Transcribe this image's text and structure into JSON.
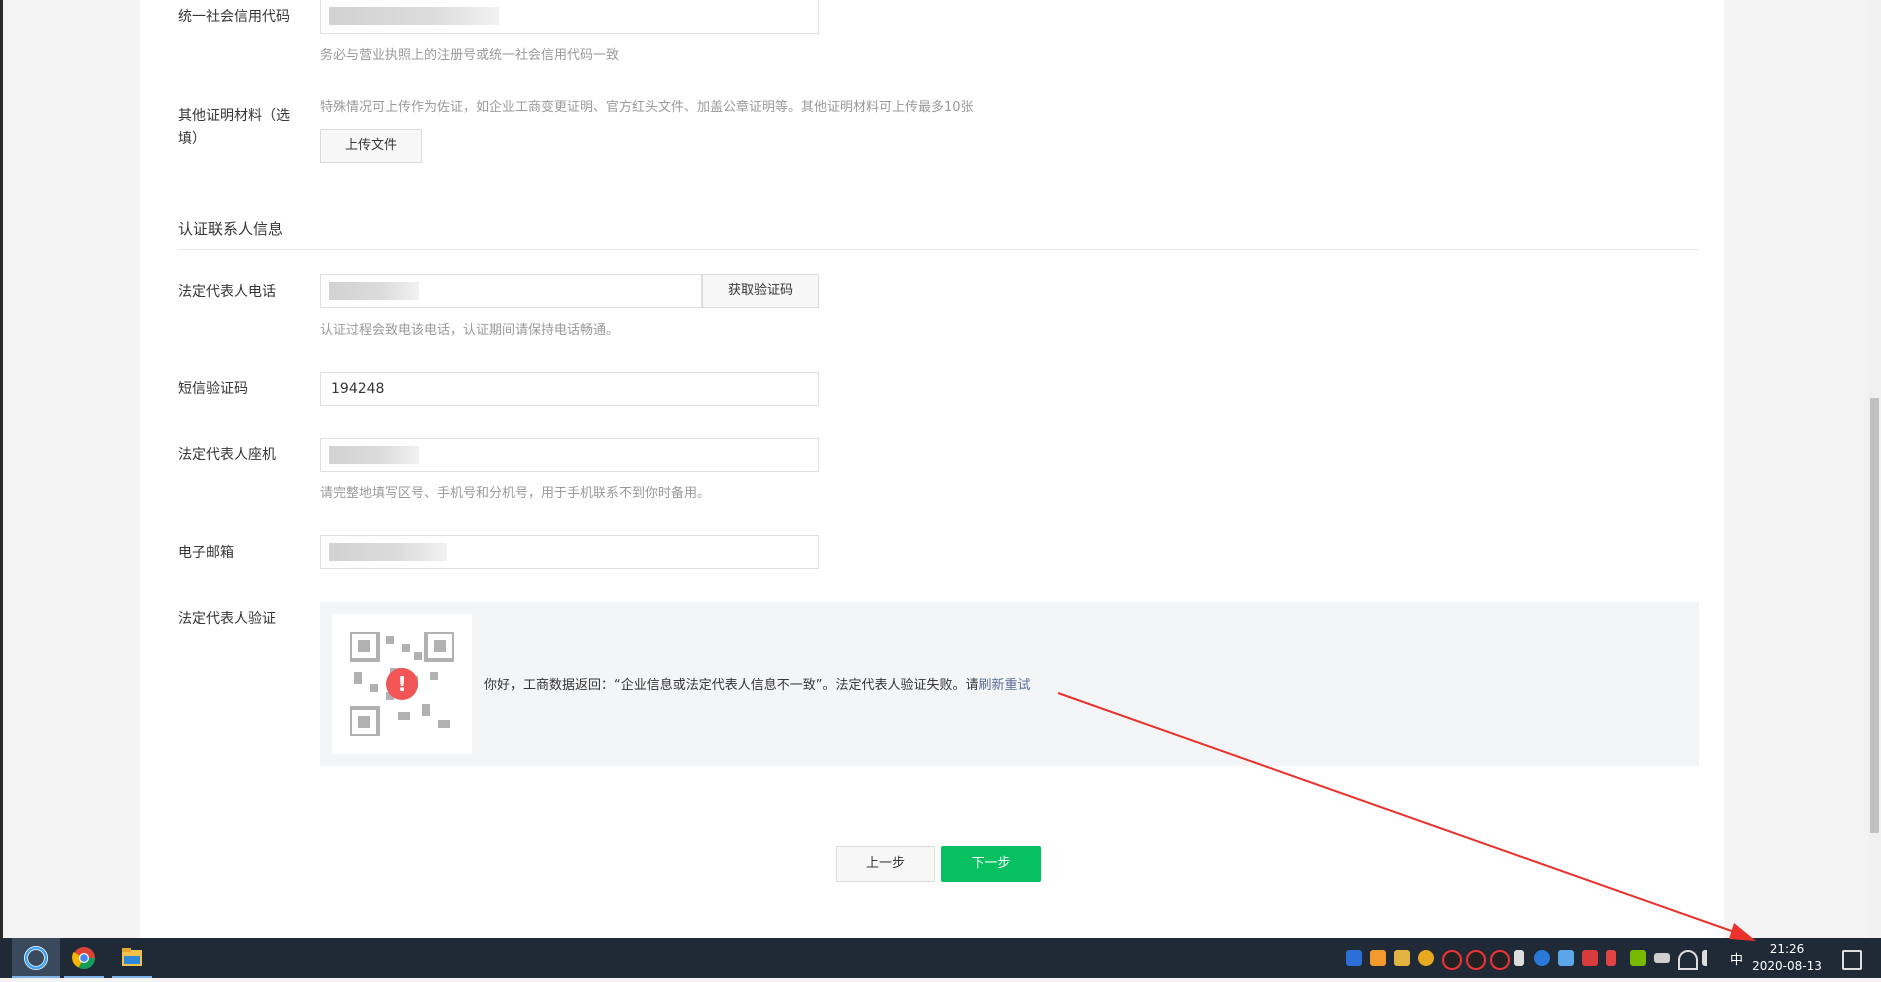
{
  "form": {
    "credit_code_label": "统一社会信用代码",
    "credit_code_hint": "务必与营业执照上的注册号或统一社会信用代码一致",
    "other_materials_label_1": "其他证明材料（选",
    "other_materials_label_2": "填）",
    "other_materials_hint": "特殊情况可上传作为佐证，如企业工商变更证明、官方红头文件、加盖公章证明等。其他证明材料可上传最多10张",
    "upload_button": "上传文件",
    "section_title": "认证联系人信息",
    "phone_label": "法定代表人电话",
    "get_code_button": "获取验证码",
    "phone_hint": "认证过程会致电该电话，认证期间请保持电话畅通。",
    "sms_label": "短信验证码",
    "sms_value": "194248",
    "landline_label": "法定代表人座机",
    "landline_hint": "请完整地填写区号、手机号和分机号，用于手机联系不到你时备用。",
    "email_label": "电子邮箱",
    "verify_label": "法定代表人验证",
    "verify_message": "你好，工商数据返回：“企业信息或法定代表人信息不一致”。法定代表人验证失败。请",
    "verify_link": "刷新重试",
    "prev_button": "上一步",
    "next_button": "下一步"
  },
  "taskbar": {
    "ime": "中",
    "time": "21:26",
    "date": "2020-08-13",
    "apps": [
      "browser-icon",
      "chrome-icon",
      "file-explorer-icon"
    ]
  },
  "colors": {
    "primary_green": "#07c160",
    "error_red": "#f25555",
    "link_blue": "#576b95",
    "annotation_red": "#e8322b"
  }
}
